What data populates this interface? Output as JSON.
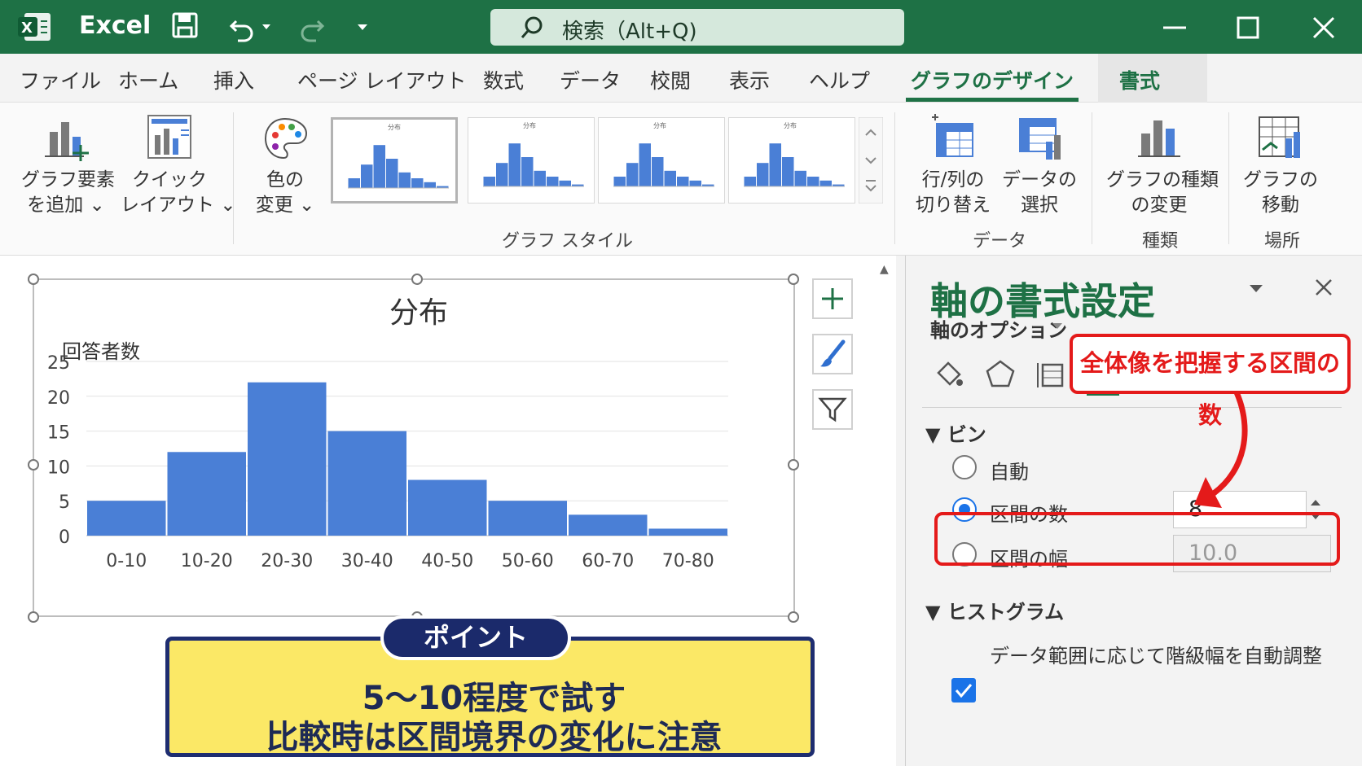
{
  "titlebar": {
    "app_name": "Excel",
    "search_text": "検索（Alt+Q)"
  },
  "tabs": [
    "ファイル",
    "ホーム",
    "挿入",
    "ページ レイアウト",
    "数式",
    "データ",
    "校閲",
    "表示",
    "ヘルプ",
    "グラフのデザイン",
    "書式"
  ],
  "ribbon": {
    "add_element": [
      "グラフ要素",
      "を追加 ⌄"
    ],
    "quick_layout": [
      "クイック",
      "レイアウト ⌄"
    ],
    "change_color": [
      "色の",
      "変更 ⌄"
    ],
    "group_styles": "グラフ スタイル",
    "thumb_title": "分布",
    "switch_rowcol": [
      "行/列の",
      "切り替え"
    ],
    "select_data": [
      "データの",
      "選択"
    ],
    "group_data": "データ",
    "change_type": [
      "グラフの種類",
      "の変更"
    ],
    "group_type": "種類",
    "move_chart": [
      "グラフの",
      "移動"
    ],
    "group_location": "場所",
    "accent": "#1e7145"
  },
  "chart_data": {
    "type": "bar",
    "title": "分布",
    "ylabel": "回答者数",
    "xlabel": "",
    "categories": [
      "0-10",
      "10-20",
      "20-30",
      "30-40",
      "40-50",
      "50-60",
      "60-70",
      "70-80"
    ],
    "values": [
      5,
      12,
      22,
      15,
      8,
      5,
      3,
      1
    ],
    "ylim": [
      0,
      25
    ],
    "yticks": [
      0,
      5,
      10,
      15,
      20,
      25
    ],
    "bar_color": "#4a7fd6",
    "grid": true
  },
  "callout": {
    "badge": "ポイント",
    "line1": "5〜10程度で試す",
    "line2": "比較時は区間境界の変化に注意"
  },
  "pane": {
    "title": "軸の書式設定",
    "axis_options": "軸のオプション",
    "annotation": "全体像を把握する区間の数",
    "bins_section": "ビン",
    "auto": "自動",
    "bin_count": "区間の数",
    "bin_count_value": "8",
    "bin_width": "区間の幅",
    "bin_width_value": "10.0",
    "histogram_section": "ヒストグラム",
    "auto_adjust": "データ範囲に応じて階級幅を自動調整",
    "selected_option": "bin_count"
  }
}
